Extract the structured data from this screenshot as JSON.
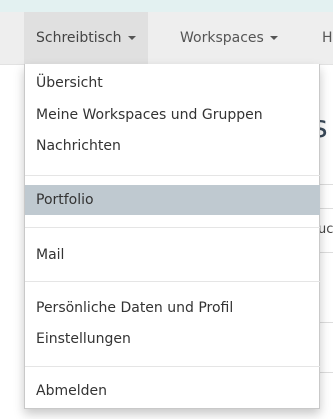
{
  "navbar": {
    "items": [
      {
        "label": "Schreibtisch",
        "active": true
      },
      {
        "label": "Workspaces",
        "active": false
      },
      {
        "label": "H",
        "active": false
      }
    ]
  },
  "background": {
    "heading_fragment": "s",
    "text_fragment": "uc"
  },
  "dropdown": {
    "groups": [
      [
        "Übersicht",
        "Meine Workspaces und Gruppen",
        "Nachrichten"
      ],
      [
        "Portfolio"
      ],
      [
        "Mail"
      ],
      [
        "Persönliche Daten und Profil",
        "Einstellungen"
      ],
      [
        "Abmelden"
      ]
    ],
    "highlighted_item": "Portfolio",
    "highlight_color": "#bfc9d0"
  }
}
